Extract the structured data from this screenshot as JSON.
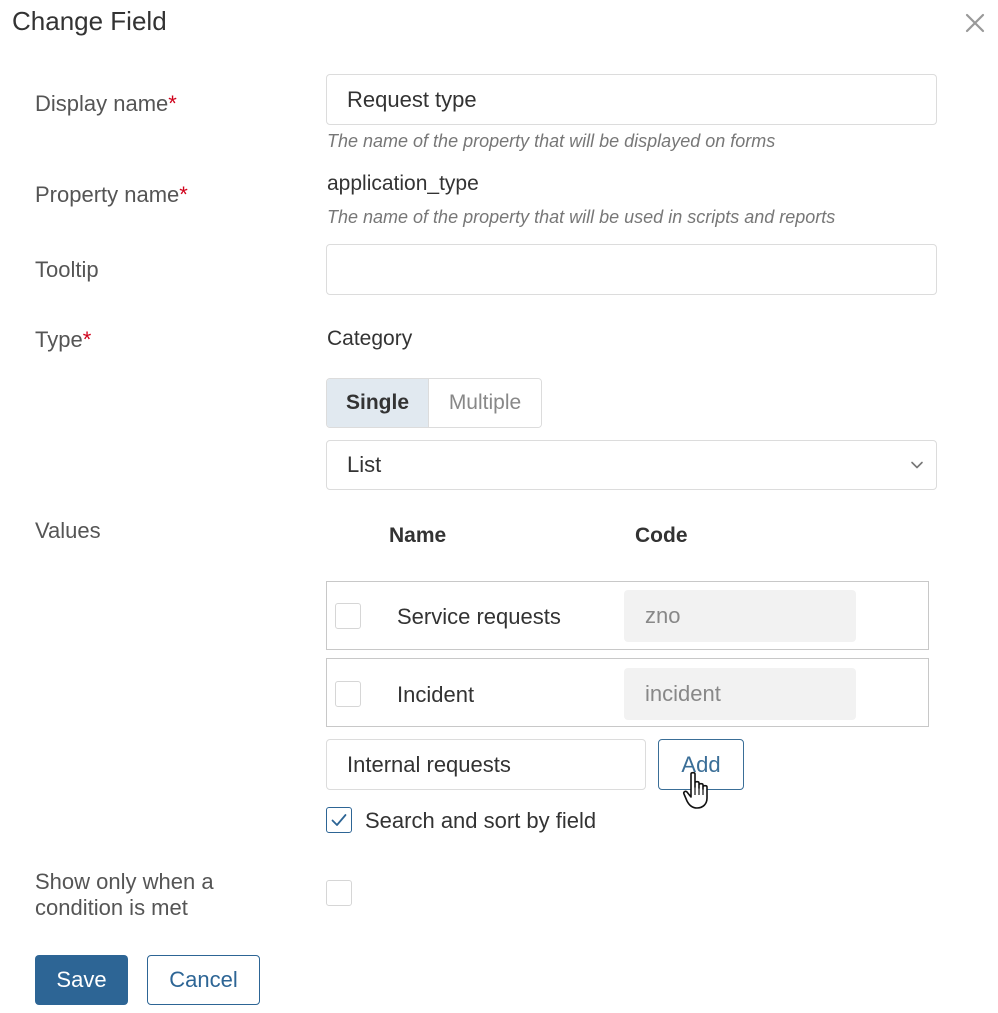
{
  "dialog": {
    "title": "Change Field"
  },
  "fields": {
    "display_name": {
      "label": "Display name",
      "required_mark": "*",
      "value": "Request type",
      "hint": "The name of the property that will be displayed on forms"
    },
    "property_name": {
      "label": "Property name",
      "required_mark": "*",
      "value": "application_type",
      "hint": "The name of the property that will be used in scripts and reports"
    },
    "tooltip": {
      "label": "Tooltip",
      "value": ""
    },
    "type": {
      "label": "Type",
      "required_mark": "*",
      "value": "Category",
      "mode_single": "Single",
      "mode_multiple": "Multiple",
      "selected_mode": "Single",
      "view": "List"
    }
  },
  "values": {
    "label": "Values",
    "col_name": "Name",
    "col_code": "Code",
    "rows": [
      {
        "name": "Service requests",
        "code": "zno"
      },
      {
        "name": "Incident",
        "code": "incident"
      }
    ],
    "new_value": "Internal requests",
    "add_label": "Add"
  },
  "search_sort": {
    "label": "Search and sort by field",
    "checked": true
  },
  "condition": {
    "label_line1": "Show only when a",
    "label_line2": "condition is met",
    "checked": false
  },
  "footer": {
    "save_label": "Save",
    "cancel_label": "Cancel"
  },
  "colors": {
    "primary": "#2d6595",
    "required": "#d0021b",
    "segment_active": "#e1e9f0"
  },
  "icons": {
    "close": "close-icon",
    "dropdown": "chevron-down-icon",
    "check": "check-icon",
    "cursor": "hand-pointer-icon"
  }
}
